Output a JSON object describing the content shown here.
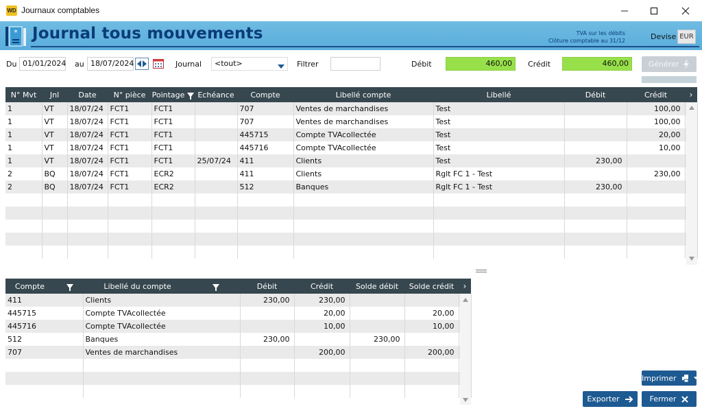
{
  "window": {
    "title": "Journaux comptables",
    "logo_text": "WD"
  },
  "header": {
    "title": "Journal tous mouvements",
    "tva_line1": "TVA sur les débits",
    "tva_line2": "Clôture comptable au 31/12",
    "devise_label": "Devise",
    "devise_value": "EUR"
  },
  "filters": {
    "du_label": "Du",
    "du_value": "01/01/2024",
    "au_label": "au",
    "au_value": "18/07/2024",
    "journal_label": "Journal",
    "journal_value": "<tout>",
    "filtrer_label": "Filtrer",
    "filtrer_value": "",
    "debit_label": "Débit",
    "debit_value": "460,00",
    "credit_label": "Crédit",
    "credit_value": "460,00",
    "generer_label": "Générer"
  },
  "main_table": {
    "headers": [
      "N° Mvt",
      "Jnl",
      "Date",
      "N° pièce",
      "Pointage",
      "Echéance",
      "Compte",
      "Libellé compte",
      "Libellé",
      "Débit",
      "Crédit"
    ],
    "rows": [
      [
        "1",
        "VT",
        "18/07/24",
        "FCT1",
        "FCT1",
        "",
        "707",
        "Ventes de marchandises",
        "Test",
        "",
        "100,00"
      ],
      [
        "1",
        "VT",
        "18/07/24",
        "FCT1",
        "FCT1",
        "",
        "707",
        "Ventes de marchandises",
        "Test",
        "",
        "100,00"
      ],
      [
        "1",
        "VT",
        "18/07/24",
        "FCT1",
        "FCT1",
        "",
        "445715",
        "Compte TVAcollectée",
        "Test",
        "",
        "20,00"
      ],
      [
        "1",
        "VT",
        "18/07/24",
        "FCT1",
        "FCT1",
        "",
        "445716",
        "Compte TVAcollectée",
        "Test",
        "",
        "10,00"
      ],
      [
        "1",
        "VT",
        "18/07/24",
        "FCT1",
        "FCT1",
        "25/07/24",
        "411",
        "Clients",
        "Test",
        "230,00",
        ""
      ],
      [
        "2",
        "BQ",
        "18/07/24",
        "FCT1",
        "ECR2",
        "",
        "411",
        "Clients",
        "Rglt FC 1 - Test",
        "",
        "230,00"
      ],
      [
        "2",
        "BQ",
        "18/07/24",
        "FCT1",
        "ECR2",
        "",
        "512",
        "Banques",
        "Rglt FC 1 - Test",
        "230,00",
        ""
      ]
    ]
  },
  "summary_table": {
    "headers": [
      "Compte",
      "Libellé du compte",
      "Débit",
      "Crédit",
      "Solde débit",
      "Solde crédit"
    ],
    "rows": [
      [
        "411",
        "Clients",
        "230,00",
        "230,00",
        "",
        ""
      ],
      [
        "445715",
        "Compte TVAcollectée",
        "",
        "20,00",
        "",
        "20,00"
      ],
      [
        "445716",
        "Compte TVAcollectée",
        "",
        "10,00",
        "",
        "10,00"
      ],
      [
        "512",
        "Banques",
        "230,00",
        "",
        "230,00",
        ""
      ],
      [
        "707",
        "Ventes de marchandises",
        "",
        "200,00",
        "",
        "200,00"
      ]
    ]
  },
  "buttons": {
    "imprimer": "Imprimer",
    "exporter": "Exporter",
    "fermer": "Fermer"
  },
  "colors": {
    "header_band": "#5aaddc",
    "title_text": "#0a3c78",
    "table_header": "#37474f",
    "total_green": "#97e04a",
    "button_blue": "#1e5a92"
  }
}
